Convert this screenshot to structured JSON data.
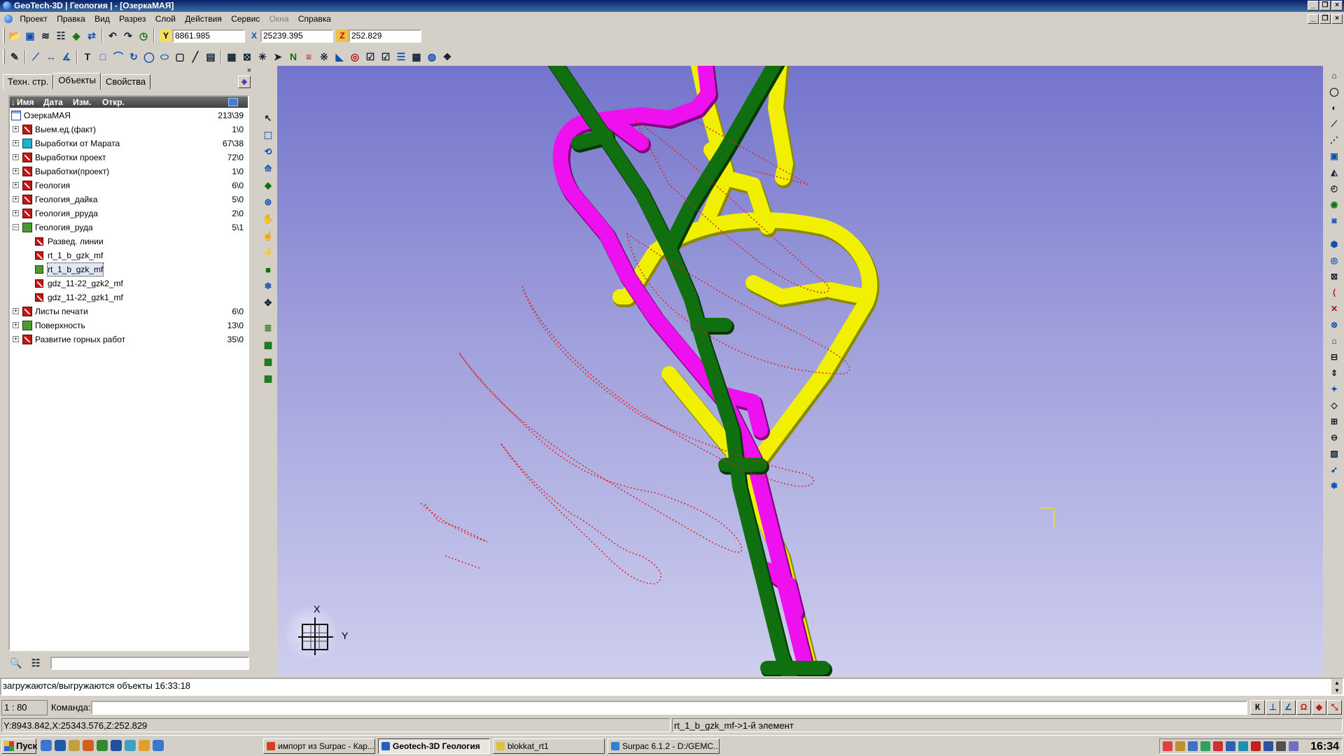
{
  "window": {
    "title": "GeoTech-3D | Геология | - [ОзеркаМАЯ]"
  },
  "menu": [
    "Проект",
    "Правка",
    "Вид",
    "Разрез",
    "Слой",
    "Действия",
    "Сервис",
    "Окна",
    "Справка"
  ],
  "coords": {
    "y_label": "Y",
    "y_value": "8861.985",
    "x_label": "X",
    "x_value": "25239.395",
    "z_label": "Z",
    "z_value": "252.829"
  },
  "panel": {
    "tabs": [
      "Техн. стр.",
      "Объекты",
      "Свойства"
    ],
    "active_tab": "Объекты",
    "columns": {
      "name": "Имя",
      "date": "Дата",
      "changed": "Изм.",
      "opened": "Откр."
    },
    "root": {
      "label": "ОзеркаМАЯ",
      "count": "213\\39"
    },
    "items": [
      {
        "label": "Выем.ед.(факт)",
        "count": "1\\0",
        "icon": "red"
      },
      {
        "label": "Выработки от Марата",
        "count": "67\\38",
        "icon": "cyan"
      },
      {
        "label": "Выработки проект",
        "count": "72\\0",
        "icon": "red"
      },
      {
        "label": "Выработки(проект)",
        "count": "1\\0",
        "icon": "red"
      },
      {
        "label": "Геология",
        "count": "6\\0",
        "icon": "red"
      },
      {
        "label": "Геология_дайка",
        "count": "5\\0",
        "icon": "red"
      },
      {
        "label": "Геология_ррyда",
        "count": "2\\0",
        "icon": "red"
      },
      {
        "label": "Геология_руда",
        "count": "5\\1",
        "icon": "green"
      }
    ],
    "children": [
      {
        "label": "Развед. линии",
        "icon": "red"
      },
      {
        "label": "rt_1_b_gzk_mf",
        "icon": "red"
      },
      {
        "label": "rt_1_b_gzk_mf",
        "icon": "green"
      },
      {
        "label": "gdz_11-22_gzk2_mf",
        "icon": "red"
      },
      {
        "label": "gdz_11-22_gzk1_mf",
        "icon": "red"
      }
    ],
    "items_after": [
      {
        "label": "Листы печати",
        "count": "6\\0",
        "icon": "red"
      },
      {
        "label": "Поверхность",
        "count": "13\\0",
        "icon": "green"
      },
      {
        "label": "Развитие горных работ",
        "count": "35\\0",
        "icon": "red"
      }
    ]
  },
  "axis": {
    "x": "X",
    "y": "Y"
  },
  "log_text": "загружаются/выгружаются объекты 16:33:18",
  "scale": "1 : 80",
  "command_label": "Команда:",
  "snap_buttons": [
    "К",
    "⊥",
    "∠",
    "Ω",
    "◆",
    "⤡"
  ],
  "status": {
    "coords": "Y:8943.842,X:25343.576,Z:252.829",
    "selection": "rt_1_b_gzk_mf->1-й элемент"
  },
  "taskbar": {
    "start": "Пуск",
    "tasks": [
      {
        "label": "импорт из Surpac - Кар...",
        "color": "#d04020"
      },
      {
        "label": "Geotech-3D Геология",
        "color": "#2060c0"
      },
      {
        "label": "blokkat_rt1",
        "color": "#e0c040"
      },
      {
        "label": "Surpac 6.1.2 - D:/GEMC...",
        "color": "#3080d0"
      }
    ],
    "clock": "16:34"
  },
  "colors": {
    "viewport_top": "#7474cc",
    "viewport_bottom": "#ceceef",
    "yellow": "#f0f000",
    "magenta": "#ee10ee",
    "green": "#107010",
    "red_lines": "#e02020"
  }
}
